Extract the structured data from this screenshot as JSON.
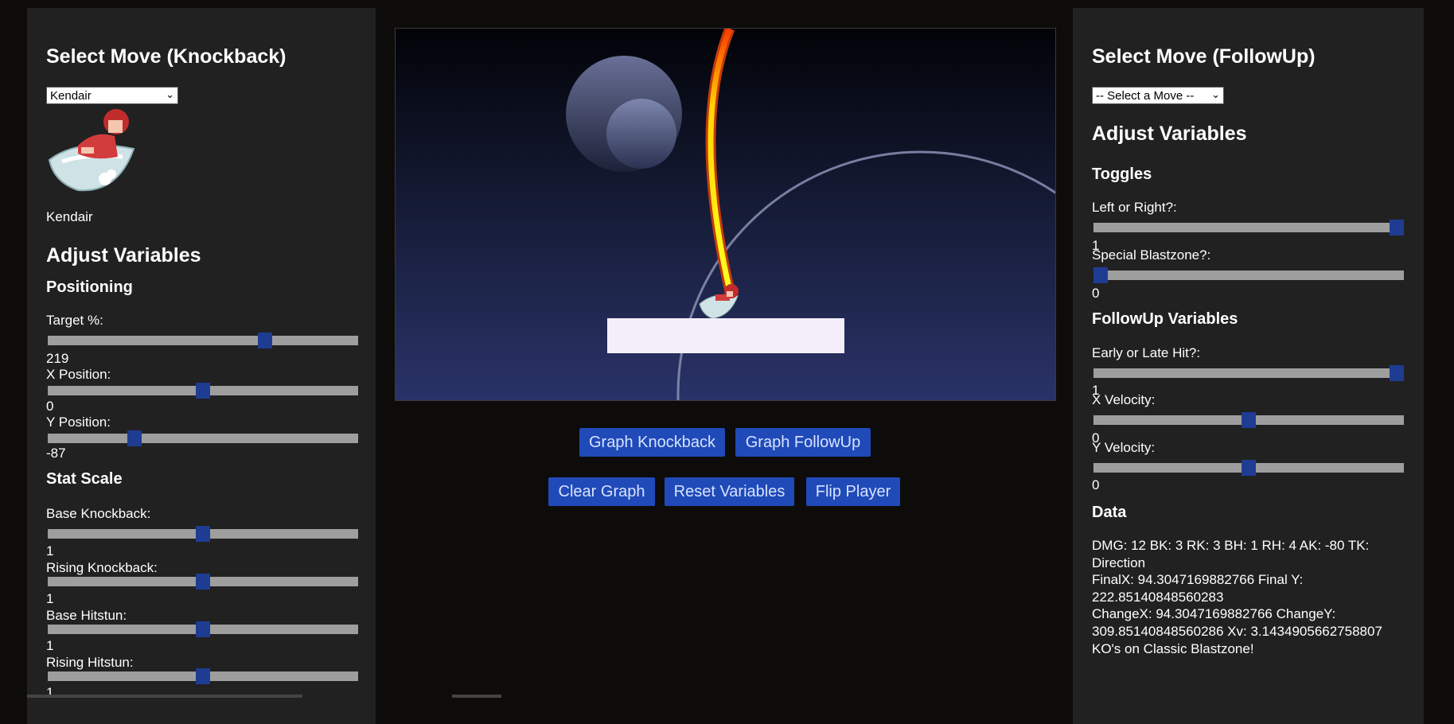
{
  "left": {
    "heading": "Select Move (Knockback)",
    "move_select": "Kendair",
    "move_name": "Kendair",
    "adjust_heading": "Adjust Variables",
    "positioning_heading": "Positioning",
    "target_label": "Target %:",
    "target_value": "219",
    "target_level": 0.71,
    "x_label": "X Position:",
    "x_value": "0",
    "x_level": 0.5,
    "y_label": "Y Position:",
    "y_value": "-87",
    "y_level": 0.27,
    "stat_heading": "Stat Scale",
    "bk_label": "Base Knockback:",
    "bk_value": "1",
    "bk_level": 0.5,
    "rk_label": "Rising Knockback:",
    "rk_value": "1",
    "rk_level": 0.5,
    "bh_label": "Base Hitstun:",
    "bh_value": "1",
    "bh_level": 0.5,
    "rh_label": "Rising Hitstun:",
    "rh_value": "1",
    "rh_level": 0.5
  },
  "buttons": {
    "graph_knockback": "Graph Knockback",
    "graph_followup": "Graph FollowUp",
    "clear_graph": "Clear Graph",
    "reset_variables": "Reset Variables",
    "flip_player": "Flip Player"
  },
  "right": {
    "heading": "Select Move (FollowUp)",
    "move_select": "-- Select a Move --",
    "adjust_heading": "Adjust Variables",
    "toggles_heading": "Toggles",
    "lr_label": "Left or Right?:",
    "lr_value": "1",
    "lr_level": 1,
    "sb_label": "Special Blastzone?:",
    "sb_value": "0",
    "sb_level": 0,
    "followup_heading": "FollowUp Variables",
    "el_label": "Early or Late Hit?:",
    "el_value": "1",
    "el_level": 1,
    "xv_label": "X Velocity:",
    "xv_value": "0",
    "xv_level": 0.5,
    "yv_label": "Y Velocity:",
    "yv_value": "0",
    "yv_level": 0.5,
    "data_heading": "Data",
    "data_lines": [
      "DMG: 12 BK: 3 RK: 3 BH: 1 RH: 4 AK: -80 TK:",
      "Direction",
      "FinalX: 94.3047169882766 Final Y:",
      "222.85140848560283",
      "ChangeX: 94.3047169882766 ChangeY:",
      "309.85140848560286 Xv: 3.1434905662758807",
      "KO's on Classic Blastzone!"
    ]
  },
  "colors": {
    "accent": "#1f4ab8",
    "slider_thumb": "#1f3c93",
    "panel": "#212121",
    "background": "#0e0b0b"
  }
}
